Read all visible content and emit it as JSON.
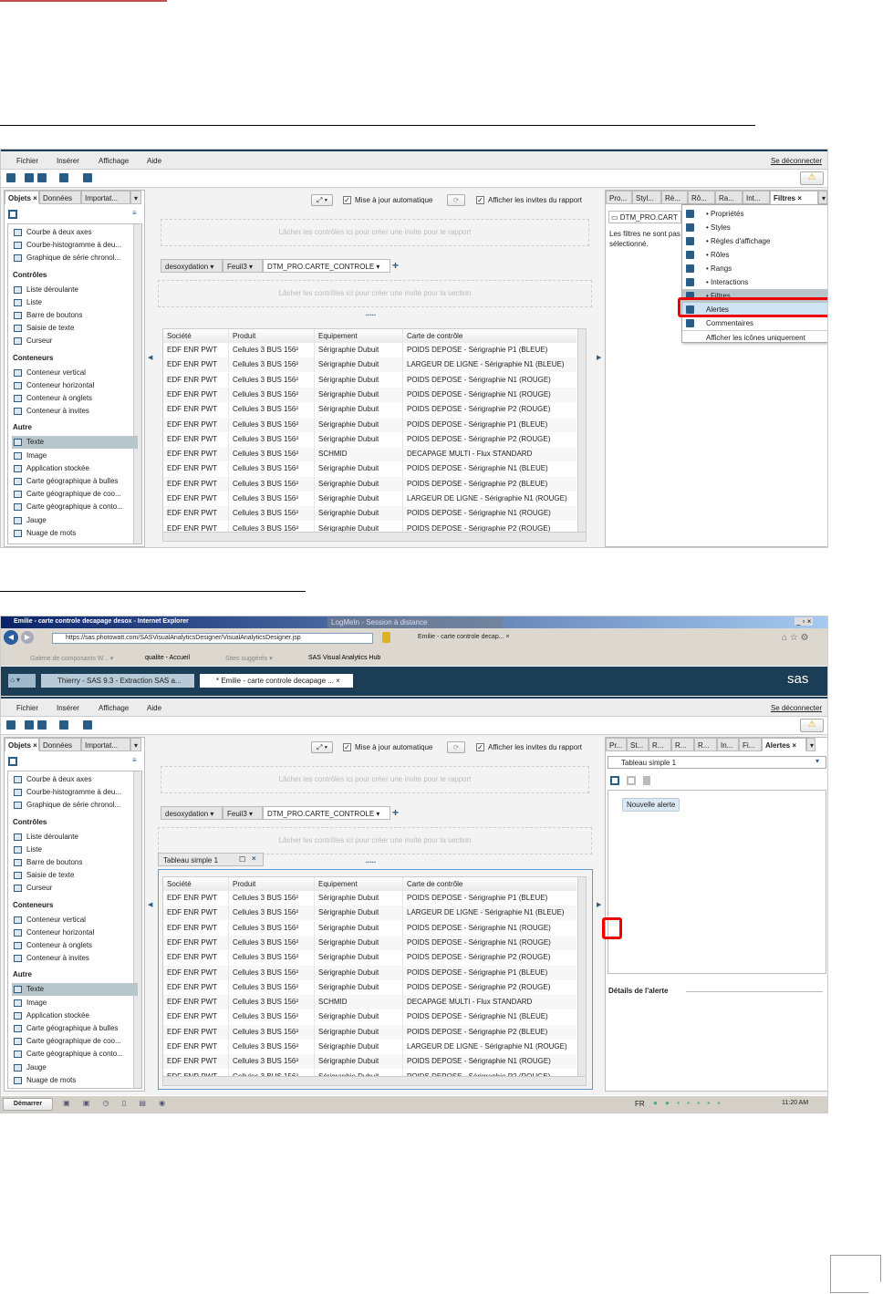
{
  "shot1": {
    "menu": [
      "Fichier",
      "Insérer",
      "Affichage",
      "Aide"
    ],
    "logout": "Se déconnecter",
    "left_tabs": [
      "Objets",
      "Données",
      "Importat..."
    ],
    "objects": [
      {
        "type": "item",
        "label": "Courbe à deux axes"
      },
      {
        "type": "item",
        "label": "Courbe-histogramme à deu..."
      },
      {
        "type": "item",
        "label": "Graphique de série chronol..."
      },
      {
        "type": "group",
        "label": "Contrôles"
      },
      {
        "type": "item",
        "label": "Liste déroulante"
      },
      {
        "type": "item",
        "label": "Liste"
      },
      {
        "type": "item",
        "label": "Barre de boutons"
      },
      {
        "type": "item",
        "label": "Saisie de texte"
      },
      {
        "type": "item",
        "label": "Curseur"
      },
      {
        "type": "group",
        "label": "Conteneurs"
      },
      {
        "type": "item",
        "label": "Conteneur vertical"
      },
      {
        "type": "item",
        "label": "Conteneur horizontal"
      },
      {
        "type": "item",
        "label": "Conteneur à onglets"
      },
      {
        "type": "item",
        "label": "Conteneur à invites"
      },
      {
        "type": "group",
        "label": "Autre"
      },
      {
        "type": "item",
        "label": "Texte",
        "selected": true
      },
      {
        "type": "item",
        "label": "Image"
      },
      {
        "type": "item",
        "label": "Application stockée"
      },
      {
        "type": "item",
        "label": "Carte géographique à bulles"
      },
      {
        "type": "item",
        "label": "Carte géographique de coo..."
      },
      {
        "type": "item",
        "label": "Carte géographique à conto..."
      },
      {
        "type": "item",
        "label": "Jauge"
      },
      {
        "type": "item",
        "label": "Nuage de mots"
      }
    ],
    "auto_update": "Mise à jour automatique",
    "show_prompts": "Afficher les invites du rapport",
    "drop_report": "Lâcher les contrôles ici pour créer une invite pour le rapport",
    "drop_section": "Lâcher les contrôles ici pour créer une invite pour la section",
    "section_tabs": [
      "desoxydation",
      "Feuil3",
      "DTM_PRO.CARTE_CONTROLE"
    ],
    "right_tabs": [
      "Pro...",
      "Styl...",
      "Rè...",
      "Rô...",
      "Ra...",
      "Int...",
      "Filtres"
    ],
    "filter_source": "DTM_PRO.CART",
    "filter_msg": "Les filtres ne sont pas sélectionné.",
    "dropdown_menu": [
      {
        "label": "• Propriétés"
      },
      {
        "label": "• Styles"
      },
      {
        "label": "• Règles d'affichage"
      },
      {
        "label": "• Rôles"
      },
      {
        "label": "• Rangs"
      },
      {
        "label": "• Interactions"
      },
      {
        "label": "• Filtres",
        "state": "current"
      },
      {
        "label": "Alertes",
        "state": "hover"
      },
      {
        "label": "Commentaires"
      },
      {
        "label": "Afficher les icônes uniquement",
        "noicon": true
      }
    ]
  },
  "table": {
    "columns": [
      "Société",
      "Produit",
      "Equipement",
      "Carte de contrôle"
    ],
    "rows": [
      [
        "EDF ENR PWT",
        "Cellules 3 BUS 156²",
        "Sérigraphie Dubuit",
        "POIDS DEPOSE - Sérigraphie P1 (BLEUE)"
      ],
      [
        "EDF ENR PWT",
        "Cellules 3 BUS 156²",
        "Sérigraphie Dubuit",
        "LARGEUR DE LIGNE - Sérigraphie N1 (BLEUE)"
      ],
      [
        "EDF ENR PWT",
        "Cellules 3 BUS 156²",
        "Sérigraphie Dubuit",
        "POIDS DEPOSE - Sérigraphie N1 (ROUGE)"
      ],
      [
        "EDF ENR PWT",
        "Cellules 3 BUS 156²",
        "Sérigraphie Dubuit",
        "POIDS DEPOSE - Sérigraphie N1 (ROUGE)"
      ],
      [
        "EDF ENR PWT",
        "Cellules 3 BUS 156²",
        "Sérigraphie Dubuit",
        "POIDS DEPOSE - Sérigraphie P2 (ROUGE)"
      ],
      [
        "EDF ENR PWT",
        "Cellules 3 BUS 156²",
        "Sérigraphie Dubuit",
        "POIDS DEPOSE - Sérigraphie P1 (BLEUE)"
      ],
      [
        "EDF ENR PWT",
        "Cellules 3 BUS 156²",
        "Sérigraphie Dubuit",
        "POIDS DEPOSE - Sérigraphie P2 (ROUGE)"
      ],
      [
        "EDF ENR PWT",
        "Cellules 3 BUS 156²",
        "SCHMID",
        "DECAPAGE MULTI - Flux STANDARD"
      ],
      [
        "EDF ENR PWT",
        "Cellules 3 BUS 156²",
        "Sérigraphie Dubuit",
        "POIDS DEPOSE - Sérigraphie N1 (BLEUE)"
      ],
      [
        "EDF ENR PWT",
        "Cellules 3 BUS 156²",
        "Sérigraphie Dubuit",
        "POIDS DEPOSE - Sérigraphie P2 (BLEUE)"
      ],
      [
        "EDF ENR PWT",
        "Cellules 3 BUS 156²",
        "Sérigraphie Dubuit",
        "LARGEUR DE LIGNE - Sérigraphie N1 (ROUGE)"
      ],
      [
        "EDF ENR PWT",
        "Cellules 3 BUS 156²",
        "Sérigraphie Dubuit",
        "POIDS DEPOSE - Sérigraphie N1 (ROUGE)"
      ],
      [
        "EDF ENR PWT",
        "Cellules 3 BUS 156²",
        "Sérigraphie Dubuit",
        "POIDS DEPOSE - Sérigraphie P2 (ROUGE)"
      ]
    ]
  },
  "shot2": {
    "window_title": "Emilie - carte controle decapage desox - Internet Explorer",
    "remote_banner": "LogMeIn - Session à distance",
    "url": "https://sas.photowatt.com/SASVisualAnalyticsDesigner/VisualAnalyticsDesigner.jsp",
    "browser_tab": "Emilie - carte controle decap...",
    "favorites": [
      "Galerie de composants W... ▾",
      "qualite - Accueil",
      "Sites suggérés ▾",
      "SAS Visual Analytics Hub"
    ],
    "app_tabs": [
      "Thierry - SAS 9.3 - Extraction SAS a...",
      "* Emilie - carte controle decapage ..."
    ],
    "logo": "sas",
    "table_tab": "Tableau simple 1",
    "right_tabs": [
      "Pr...",
      "St...",
      "R...",
      "R...",
      "R...",
      "In...",
      "Fi...",
      "Alertes"
    ],
    "object_select": "Tableau simple 1",
    "tooltip": "Nouvelle alerte",
    "details": "Détails de l'alerte",
    "start": "Démarrer",
    "lang": "FR",
    "clock": "11:20 AM"
  }
}
